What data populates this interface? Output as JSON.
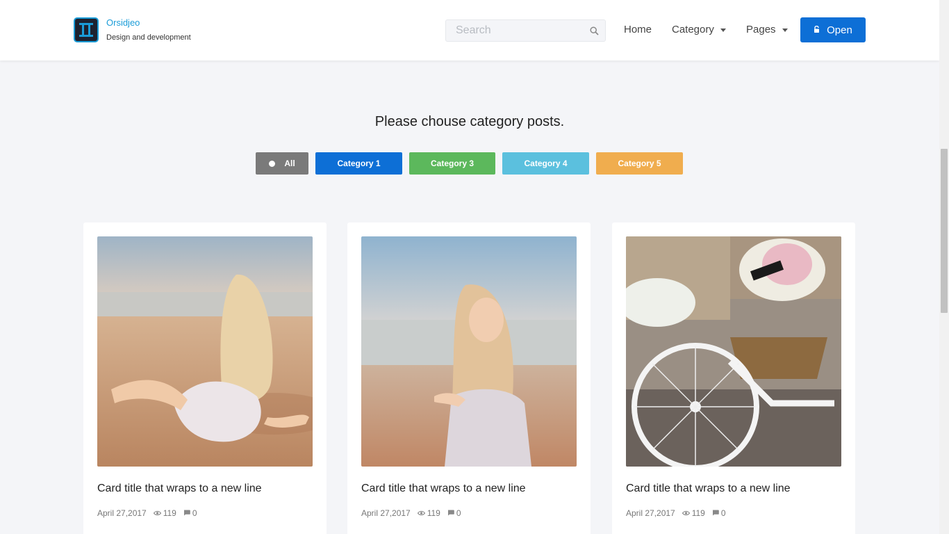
{
  "brand": {
    "name": "Orsidjeo",
    "tagline": "Design and development"
  },
  "search": {
    "placeholder": "Search"
  },
  "nav": {
    "home": "Home",
    "category": "Category",
    "pages": "Pages"
  },
  "open_button": {
    "label": "Open"
  },
  "prompt": "Please chouse category posts.",
  "filters": [
    {
      "label": "All",
      "color": "#7a7a7a"
    },
    {
      "label": "Category 1",
      "color": "#0d6fd6"
    },
    {
      "label": "Category 3",
      "color": "#5cb85c"
    },
    {
      "label": "Category 4",
      "color": "#5bc0de"
    },
    {
      "label": "Category 5",
      "color": "#f0ad4e"
    }
  ],
  "cards": [
    {
      "title": "Card title that wraps to a new line",
      "date": "April 27,2017",
      "views": "119",
      "comments": "0"
    },
    {
      "title": "Card title that wraps to a new line",
      "date": "April 27,2017",
      "views": "119",
      "comments": "0"
    },
    {
      "title": "Card title that wraps to a new line",
      "date": "April 27,2017",
      "views": "119",
      "comments": "0"
    }
  ],
  "colors": {
    "accent": "#0d6fd6",
    "brand": "#1a9cd8",
    "background": "#f4f5f8"
  }
}
